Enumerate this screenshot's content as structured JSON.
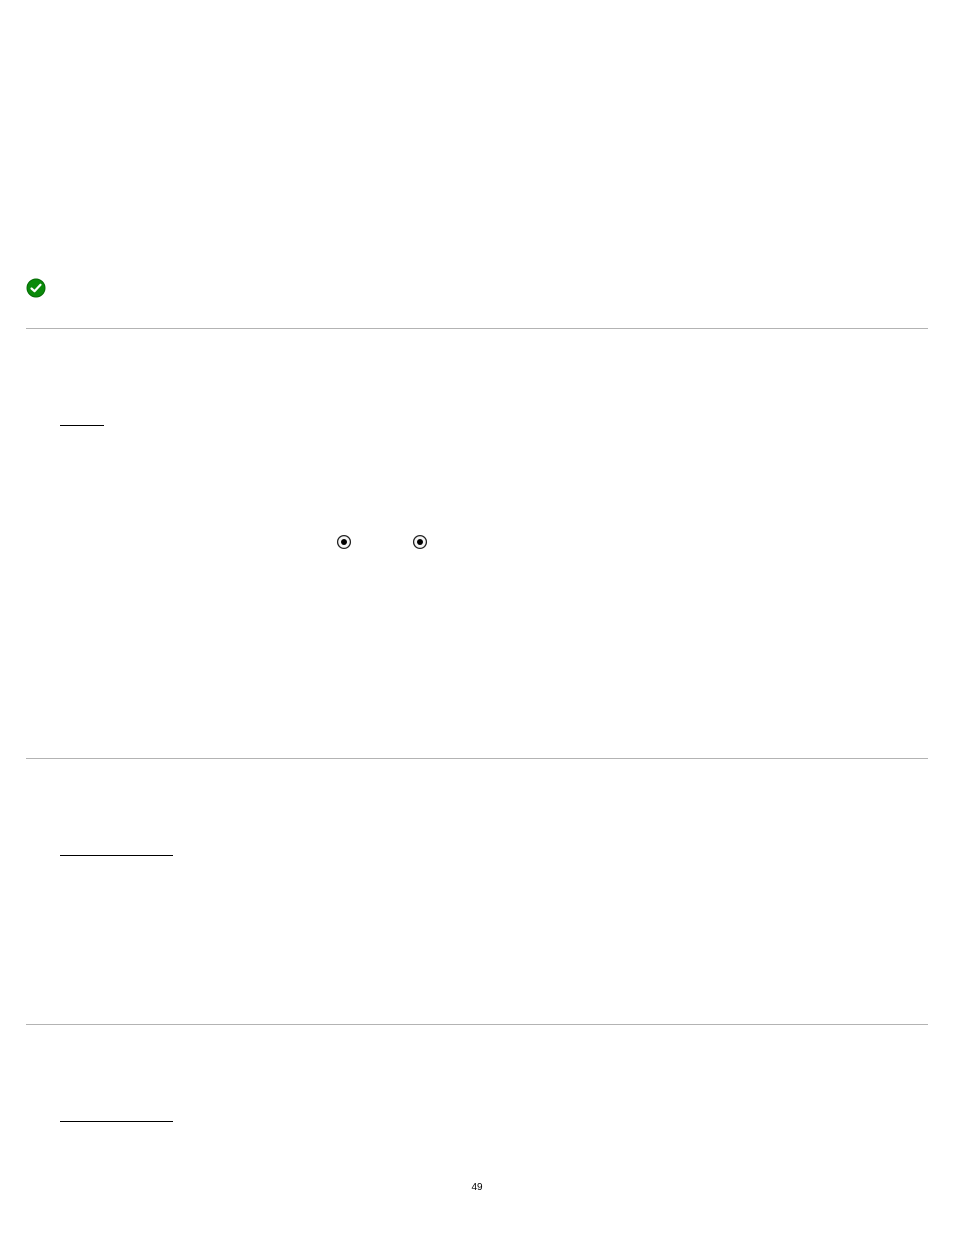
{
  "page_number": "49",
  "bullets": [
    "",
    "",
    ""
  ]
}
